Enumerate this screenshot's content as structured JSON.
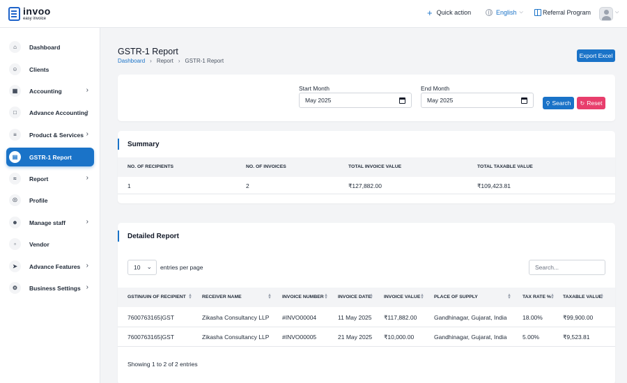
{
  "brand": {
    "name": "invoo",
    "tagline": "easy invoice",
    "accent": "#1a73c8",
    "danger": "#e83e6c"
  },
  "topbar": {
    "quick_action": "Quick action",
    "language": "English",
    "referral": "Referral Program",
    "icons": [
      "plus-icon",
      "globe-icon",
      "gift-icon",
      "user-avatar",
      "chevron-down-icon"
    ]
  },
  "sidebar": {
    "items": [
      {
        "label": "Dashboard",
        "icon": "home-icon",
        "has_submenu": false
      },
      {
        "label": "Clients",
        "icon": "user-plus-icon",
        "has_submenu": false
      },
      {
        "label": "Accounting",
        "icon": "calculator-icon",
        "has_submenu": true
      },
      {
        "label": "Advance Accounting",
        "icon": "bank-icon",
        "has_submenu": true
      },
      {
        "label": "Product & Services",
        "icon": "cart-icon",
        "has_submenu": true
      },
      {
        "label": "GSTR-1 Report",
        "icon": "document-icon",
        "has_submenu": false,
        "active": true
      },
      {
        "label": "Report",
        "icon": "chart-line-icon",
        "has_submenu": true
      },
      {
        "label": "Profile",
        "icon": "person-icon",
        "has_submenu": false
      },
      {
        "label": "Manage staff",
        "icon": "users-icon",
        "has_submenu": true
      },
      {
        "label": "Vendor",
        "icon": "note-icon",
        "has_submenu": false
      },
      {
        "label": "Advance Features",
        "icon": "rocket-icon",
        "has_submenu": true
      },
      {
        "label": "Business Settings",
        "icon": "gear-icon",
        "has_submenu": true
      }
    ]
  },
  "page": {
    "title": "GSTR-1 Report",
    "breadcrumb": [
      "Dashboard",
      "Report",
      "GSTR-1 Report"
    ],
    "export_label": "Export Excel"
  },
  "filters": {
    "start_label": "Start Month",
    "start_value": "May 2025",
    "end_label": "End Month",
    "end_value": "May 2025",
    "search_label": "Search",
    "reset_label": "Reset"
  },
  "summary": {
    "title": "Summary",
    "headers": [
      "NO. OF RECIPIENTS",
      "NO. OF INVOICES",
      "TOTAL INVOICE VALUE",
      "TOTAL TAXABLE VALUE"
    ],
    "row": [
      "1",
      "2",
      "₹127,882.00",
      "₹109,423.81"
    ]
  },
  "detailed": {
    "title": "Detailed Report",
    "entries_value": "10",
    "entries_label": "entries per page",
    "search_placeholder": "Search...",
    "headers": [
      "GSTIN/UIN OF RECIPIENT",
      "RECEIVER NAME",
      "INVOICE NUMBER",
      "INVOICE DATE",
      "INVOICE VALUE",
      "PLACE OF SUPPLY",
      "TAX RATE %",
      "TAXABLE VALUE"
    ],
    "rows": [
      [
        "7600763165|GST",
        "Zikasha Consultancy LLP",
        "#INVO00004",
        "11 May 2025",
        "₹117,882.00",
        "Gandhinagar, Gujarat, India",
        "18.00%",
        "₹99,900.00"
      ],
      [
        "7600763165|GST",
        "Zikasha Consultancy LLP",
        "#INVO00005",
        "21 May 2025",
        "₹10,000.00",
        "Gandhinagar, Gujarat, India",
        "5.00%",
        "₹9,523.81"
      ]
    ],
    "showing": "Showing 1 to 2 of 2 entries"
  }
}
